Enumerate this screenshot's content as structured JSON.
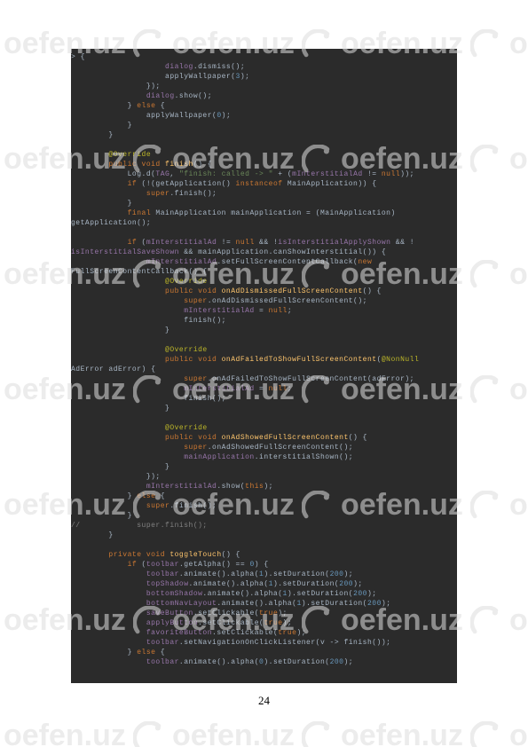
{
  "page_number": "24",
  "watermark_text": "oefen.uz",
  "code": {
    "lines": [
      [
        [
          "> {",
          ""
        ]
      ],
      [
        [
          "                    ",
          ""
        ],
        [
          "dialog",
          ".f"
        ],
        [
          ".dismiss()",
          ""
        ],
        [
          ";",
          ""
        ]
      ],
      [
        [
          "                    applyWallpaper(",
          ""
        ],
        [
          "3",
          ".n"
        ],
        [
          ")",
          ""
        ],
        [
          ";",
          ""
        ]
      ],
      [
        [
          "                })",
          ""
        ],
        [
          ";",
          ""
        ]
      ],
      [
        [
          "                ",
          ""
        ],
        [
          "dialog",
          ".f"
        ],
        [
          ".show()",
          ""
        ],
        [
          ";",
          ""
        ]
      ],
      [
        [
          "            } ",
          ""
        ],
        [
          "else",
          ".k"
        ],
        [
          " {",
          ""
        ]
      ],
      [
        [
          "                applyWallpaper(",
          ""
        ],
        [
          "0",
          ".n"
        ],
        [
          ")",
          ""
        ],
        [
          ";",
          ""
        ]
      ],
      [
        [
          "            }",
          ""
        ]
      ],
      [
        [
          "        }",
          ""
        ]
      ],
      [
        [
          "",
          ""
        ]
      ],
      [
        [
          "        ",
          ""
        ],
        [
          "@Override",
          ".a"
        ]
      ],
      [
        [
          "        ",
          ""
        ],
        [
          "public void ",
          ".k"
        ],
        [
          "finish",
          ".m"
        ],
        [
          "() {",
          ""
        ]
      ],
      [
        [
          "            Log.d(",
          ""
        ],
        [
          "TAG",
          ".f"
        ],
        [
          ", ",
          ""
        ],
        [
          "\"finish: called -> \"",
          ".s"
        ],
        [
          " + (",
          ""
        ],
        [
          "mInterstitialAd",
          ".f"
        ],
        [
          " != ",
          ""
        ],
        [
          "null",
          ".k"
        ],
        [
          "))",
          ""
        ],
        [
          ";",
          ""
        ]
      ],
      [
        [
          "            ",
          ""
        ],
        [
          "if ",
          ".k"
        ],
        [
          "(!(getApplication() ",
          ""
        ],
        [
          "instanceof ",
          ".k"
        ],
        [
          "MainApplication)) {",
          ""
        ]
      ],
      [
        [
          "                ",
          ""
        ],
        [
          "super",
          ".k"
        ],
        [
          ".finish()",
          ""
        ],
        [
          ";",
          ""
        ]
      ],
      [
        [
          "            }",
          ""
        ]
      ],
      [
        [
          "            ",
          ""
        ],
        [
          "final ",
          ".k"
        ],
        [
          "MainApplication mainApplication = (MainApplication) ",
          ""
        ]
      ],
      [
        [
          "getApplication()",
          ""
        ],
        [
          ";",
          ""
        ]
      ],
      [
        [
          "",
          ""
        ]
      ],
      [
        [
          "            ",
          ""
        ],
        [
          "if ",
          ".k"
        ],
        [
          "(",
          ""
        ],
        [
          "mInterstitialAd",
          ".f"
        ],
        [
          " != ",
          ""
        ],
        [
          "null",
          ".k"
        ],
        [
          " && !",
          ""
        ],
        [
          "isInterstitialApplyShown",
          ".f"
        ],
        [
          " && !",
          ""
        ]
      ],
      [
        [
          "isInterstitialSaveShown",
          ".f"
        ],
        [
          " && mainApplication.canShowInterstitial())",
          ""
        ],
        [
          " {",
          ""
        ]
      ],
      [
        [
          "                ",
          ""
        ],
        [
          "mInterstitialAd",
          ".f"
        ],
        [
          ".setFullScreenContentCallback(",
          ""
        ],
        [
          "new ",
          ".k"
        ]
      ],
      [
        [
          "FullScreenContentCallback() {",
          ""
        ]
      ],
      [
        [
          "                    ",
          ""
        ],
        [
          "@Override",
          ".a"
        ]
      ],
      [
        [
          "                    ",
          ""
        ],
        [
          "public void ",
          ".k"
        ],
        [
          "onAdDismissedFullScreenContent",
          ".m"
        ],
        [
          "() {",
          ""
        ]
      ],
      [
        [
          "                        ",
          ""
        ],
        [
          "super",
          ".k"
        ],
        [
          ".onAdDismissedFullScreenContent()",
          ""
        ],
        [
          ";",
          ""
        ]
      ],
      [
        [
          "                        ",
          ""
        ],
        [
          "mInterstitialAd",
          ".f"
        ],
        [
          " = ",
          ""
        ],
        [
          "null",
          ".k"
        ],
        [
          ";",
          ""
        ]
      ],
      [
        [
          "                        finish()",
          ""
        ],
        [
          ";",
          ""
        ]
      ],
      [
        [
          "                    }",
          ""
        ]
      ],
      [
        [
          "",
          ""
        ]
      ],
      [
        [
          "                    ",
          ""
        ],
        [
          "@Override",
          ".a"
        ]
      ],
      [
        [
          "                    ",
          ""
        ],
        [
          "public void ",
          ".k"
        ],
        [
          "onAdFailedToShowFullScreenContent",
          ".m"
        ],
        [
          "(",
          ""
        ],
        [
          "@NonNull",
          ".a"
        ]
      ],
      [
        [
          "AdError adError) {",
          ""
        ]
      ],
      [
        [
          "                        ",
          ""
        ],
        [
          "super",
          ".k"
        ],
        [
          ".onAdFailedToShowFullScreenContent(adError)",
          ""
        ],
        [
          ";",
          ""
        ]
      ],
      [
        [
          "                        ",
          ""
        ],
        [
          "mInterstitialAd",
          ".f"
        ],
        [
          " = ",
          ""
        ],
        [
          "null",
          ".k"
        ],
        [
          ";",
          ""
        ]
      ],
      [
        [
          "                        finish()",
          ""
        ],
        [
          ";",
          ""
        ]
      ],
      [
        [
          "                    }",
          ""
        ]
      ],
      [
        [
          "",
          ""
        ]
      ],
      [
        [
          "                    ",
          ""
        ],
        [
          "@Override",
          ".a"
        ]
      ],
      [
        [
          "                    ",
          ""
        ],
        [
          "public void ",
          ".k"
        ],
        [
          "onAdShowedFullScreenContent",
          ".m"
        ],
        [
          "() {",
          ""
        ]
      ],
      [
        [
          "                        ",
          ""
        ],
        [
          "super",
          ".k"
        ],
        [
          ".onAdShowedFullScreenContent()",
          ""
        ],
        [
          ";",
          ""
        ]
      ],
      [
        [
          "                        ",
          ""
        ],
        [
          "mainApplication",
          ".f"
        ],
        [
          ".interstitialShown()",
          ""
        ],
        [
          ";",
          ""
        ]
      ],
      [
        [
          "                    }",
          ""
        ]
      ],
      [
        [
          "                })",
          ""
        ],
        [
          ";",
          ""
        ]
      ],
      [
        [
          "                ",
          ""
        ],
        [
          "mInterstitialAd",
          ".f"
        ],
        [
          ".show(",
          ""
        ],
        [
          "this",
          ".k"
        ],
        [
          ")",
          ""
        ],
        [
          ";",
          ""
        ]
      ],
      [
        [
          "            } ",
          ""
        ],
        [
          "else",
          ".k"
        ],
        [
          " {",
          ""
        ]
      ],
      [
        [
          "                ",
          ""
        ],
        [
          "super",
          ".k"
        ],
        [
          ".finish()",
          ""
        ],
        [
          ";",
          ""
        ]
      ],
      [
        [
          "            }",
          ""
        ]
      ],
      [
        [
          "//            super.finish();",
          ".c"
        ]
      ],
      [
        [
          "        }",
          ""
        ]
      ],
      [
        [
          "",
          ""
        ]
      ],
      [
        [
          "        ",
          ""
        ],
        [
          "private void ",
          ".k"
        ],
        [
          "toggleTouch",
          ".m"
        ],
        [
          "() {",
          ""
        ]
      ],
      [
        [
          "            ",
          ""
        ],
        [
          "if ",
          ".k"
        ],
        [
          "(",
          ""
        ],
        [
          "toolbar",
          ".f"
        ],
        [
          ".getAlpha() == ",
          ""
        ],
        [
          "0",
          ".n"
        ],
        [
          ") {",
          ""
        ]
      ],
      [
        [
          "                ",
          ""
        ],
        [
          "toolbar",
          ".f"
        ],
        [
          ".animate().alpha(",
          ""
        ],
        [
          "1",
          ".n"
        ],
        [
          ").setDuration(",
          ""
        ],
        [
          "200",
          ".n"
        ],
        [
          ")",
          ""
        ],
        [
          ";",
          ""
        ]
      ],
      [
        [
          "                ",
          ""
        ],
        [
          "topShadow",
          ".f"
        ],
        [
          ".animate().alpha(",
          ""
        ],
        [
          "1",
          ".n"
        ],
        [
          ").setDuration(",
          ""
        ],
        [
          "200",
          ".n"
        ],
        [
          ")",
          ""
        ],
        [
          ";",
          ""
        ]
      ],
      [
        [
          "                ",
          ""
        ],
        [
          "bottomShadow",
          ".f"
        ],
        [
          ".animate().alpha(",
          ""
        ],
        [
          "1",
          ".n"
        ],
        [
          ").setDuration(",
          ""
        ],
        [
          "200",
          ".n"
        ],
        [
          ")",
          ""
        ],
        [
          ";",
          ""
        ]
      ],
      [
        [
          "                ",
          ""
        ],
        [
          "bottomNavLayout",
          ".f"
        ],
        [
          ".animate().alpha(",
          ""
        ],
        [
          "1",
          ".n"
        ],
        [
          ").setDuration(",
          ""
        ],
        [
          "200",
          ".n"
        ],
        [
          ")",
          ""
        ],
        [
          ";",
          ""
        ]
      ],
      [
        [
          "                ",
          ""
        ],
        [
          "saveButton",
          ".f"
        ],
        [
          ".setClickable(",
          ""
        ],
        [
          "true",
          ".k"
        ],
        [
          ")",
          ""
        ],
        [
          ";",
          ""
        ]
      ],
      [
        [
          "                ",
          ""
        ],
        [
          "applyButton",
          ".f"
        ],
        [
          ".setClickable(",
          ""
        ],
        [
          "true",
          ".k"
        ],
        [
          ")",
          ""
        ],
        [
          ";",
          ""
        ]
      ],
      [
        [
          "                ",
          ""
        ],
        [
          "favoriteButton",
          ".f"
        ],
        [
          ".setClickable(",
          ""
        ],
        [
          "true",
          ".k"
        ],
        [
          ")",
          ""
        ],
        [
          ";",
          ""
        ]
      ],
      [
        [
          "                ",
          ""
        ],
        [
          "toolbar",
          ".f"
        ],
        [
          ".setNavigationOnClickListener(v -> finish())",
          ""
        ],
        [
          ";",
          ""
        ]
      ],
      [
        [
          "            } ",
          ""
        ],
        [
          "else",
          ".k"
        ],
        [
          " {",
          ""
        ]
      ],
      [
        [
          "                ",
          ""
        ],
        [
          "toolbar",
          ".f"
        ],
        [
          ".animate().alpha(",
          ""
        ],
        [
          "0",
          ".n"
        ],
        [
          ").setDuration(",
          ""
        ],
        [
          "200",
          ".n"
        ],
        [
          ")",
          ""
        ],
        [
          ";",
          ""
        ]
      ]
    ]
  }
}
